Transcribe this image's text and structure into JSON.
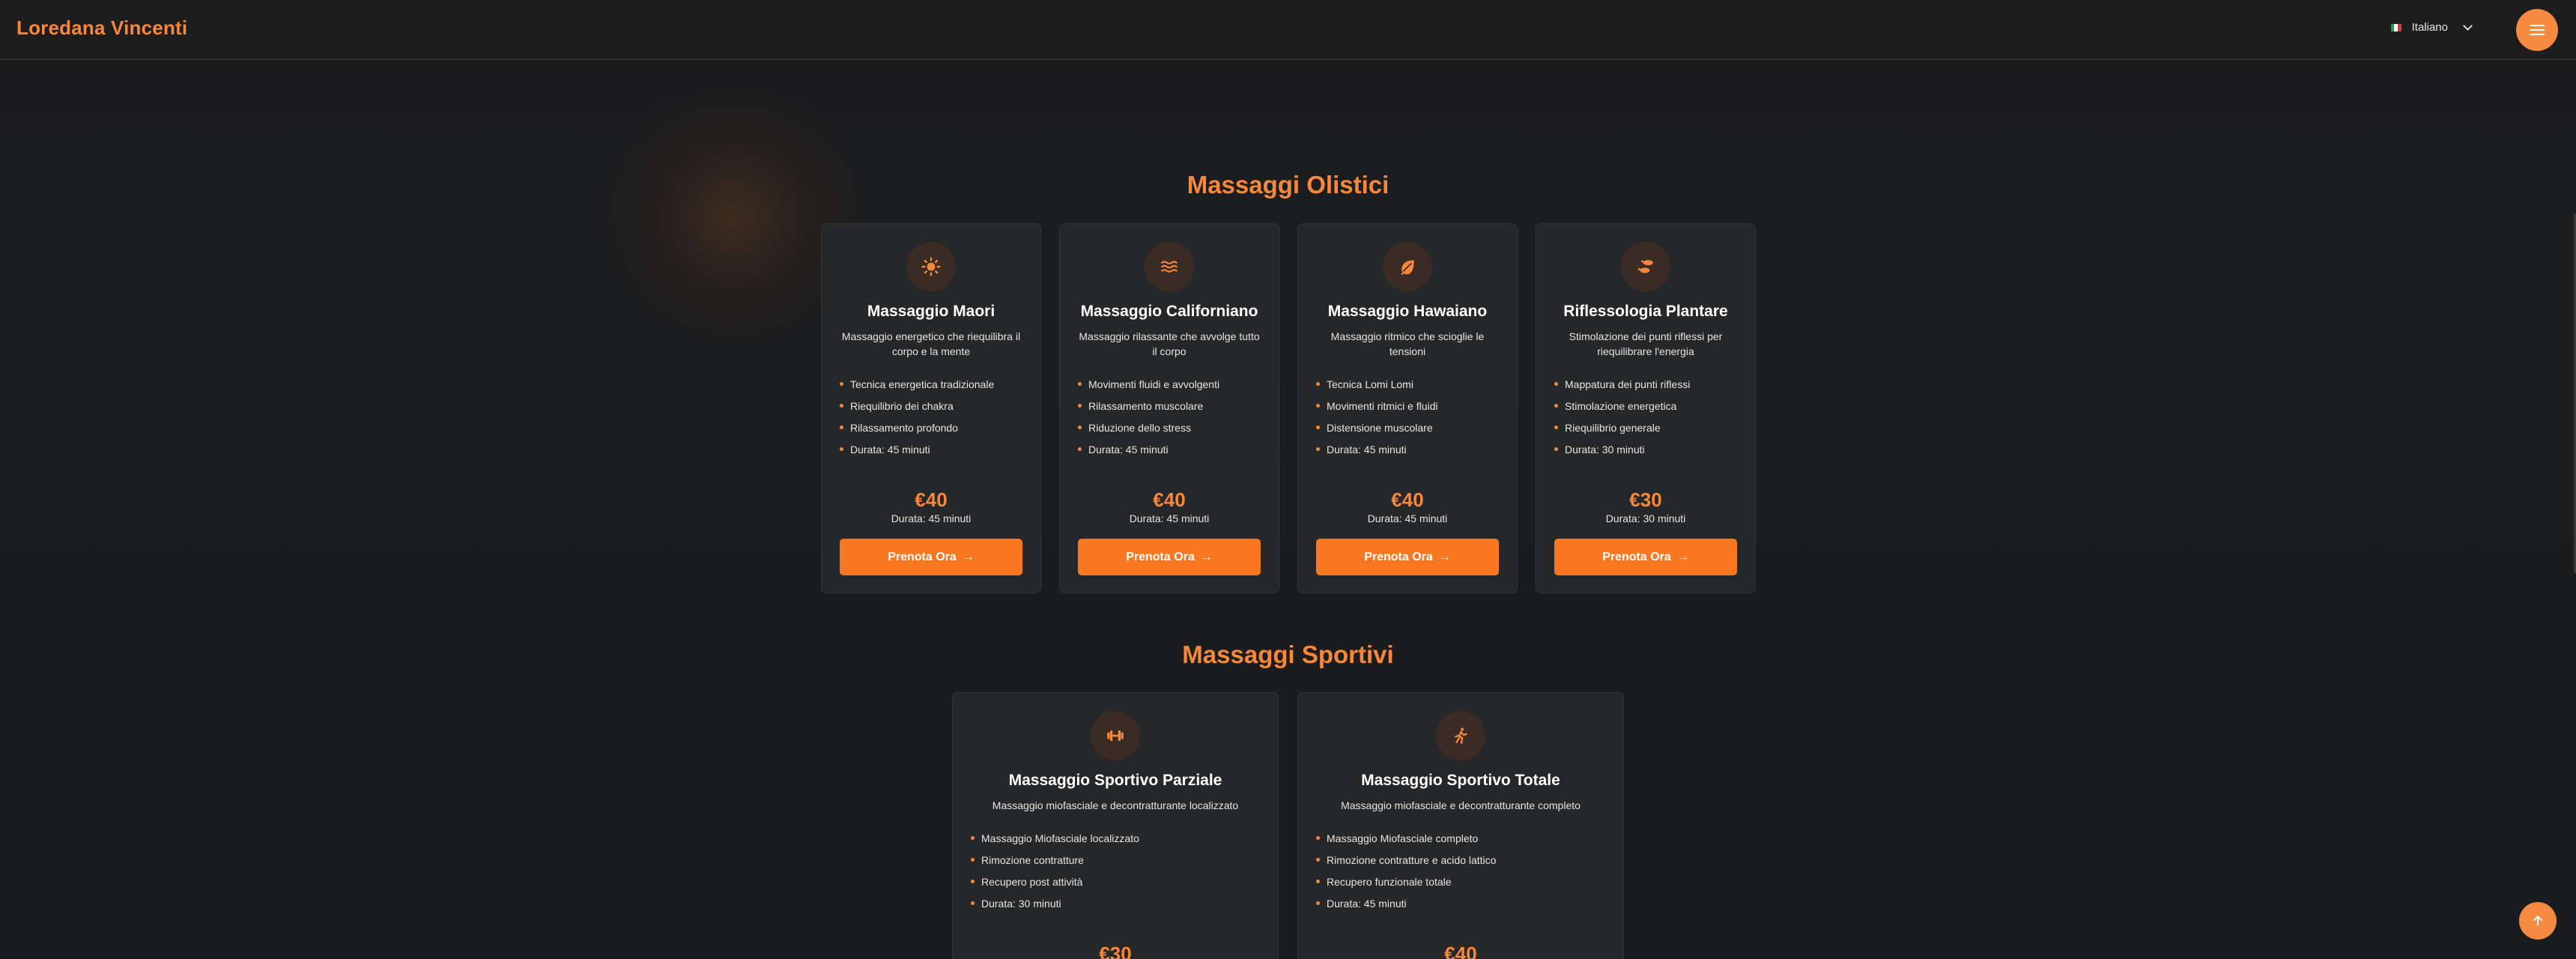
{
  "header": {
    "brand": "Loredana Vincenti",
    "language": "Italiano"
  },
  "sections": [
    {
      "title": "Massaggi Olistici",
      "cards": [
        {
          "icon": "sun-icon",
          "title": "Massaggio Maori",
          "description": "Massaggio energetico che riequilibra il corpo e la mente",
          "features": [
            "Tecnica energetica tradizionale",
            "Riequilibrio dei chakra",
            "Rilassamento profondo",
            "Durata: 45 minuti"
          ],
          "price": "€40",
          "duration": "Durata: 45 minuti",
          "button": "Prenota Ora"
        },
        {
          "icon": "water-icon",
          "title": "Massaggio Californiano",
          "description": "Massaggio rilassante che avvolge tutto il corpo",
          "features": [
            "Movimenti fluidi e avvolgenti",
            "Rilassamento muscolare",
            "Riduzione dello stress",
            "Durata: 45 minuti"
          ],
          "price": "€40",
          "duration": "Durata: 45 minuti",
          "button": "Prenota Ora"
        },
        {
          "icon": "leaf-icon",
          "title": "Massaggio Hawaiano",
          "description": "Massaggio ritmico che scioglie le tensioni",
          "features": [
            "Tecnica Lomi Lomi",
            "Movimenti ritmici e fluidi",
            "Distensione muscolare",
            "Durata: 45 minuti"
          ],
          "price": "€40",
          "duration": "Durata: 45 minuti",
          "button": "Prenota Ora"
        },
        {
          "icon": "footprints-icon",
          "title": "Riflessologia Plantare",
          "description": "Stimolazione dei punti riflessi per riequilibrare l'energia",
          "features": [
            "Mappatura dei punti riflessi",
            "Stimolazione energetica",
            "Riequilibrio generale",
            "Durata: 30 minuti"
          ],
          "price": "€30",
          "duration": "Durata: 30 minuti",
          "button": "Prenota Ora"
        }
      ]
    },
    {
      "title": "Massaggi Sportivi",
      "cards": [
        {
          "icon": "dumbbell-icon",
          "title": "Massaggio Sportivo Parziale",
          "description": "Massaggio miofasciale e decontratturante localizzato",
          "features": [
            "Massaggio Miofasciale localizzato",
            "Rimozione contratture",
            "Recupero post attività",
            "Durata: 30 minuti"
          ],
          "price": "€30"
        },
        {
          "icon": "runner-icon",
          "title": "Massaggio Sportivo Totale",
          "description": "Massaggio miofasciale e decontratturante completo",
          "features": [
            "Massaggio Miofasciale completo",
            "Rimozione contratture e acido lattico",
            "Recupero funzionale totale",
            "Durata: 45 minuti"
          ],
          "price": "€40"
        }
      ]
    }
  ],
  "colors": {
    "accent": "#f7873a",
    "button": "#f77820",
    "card_bg": "#262728",
    "page_bg": "#1b1c1e"
  }
}
